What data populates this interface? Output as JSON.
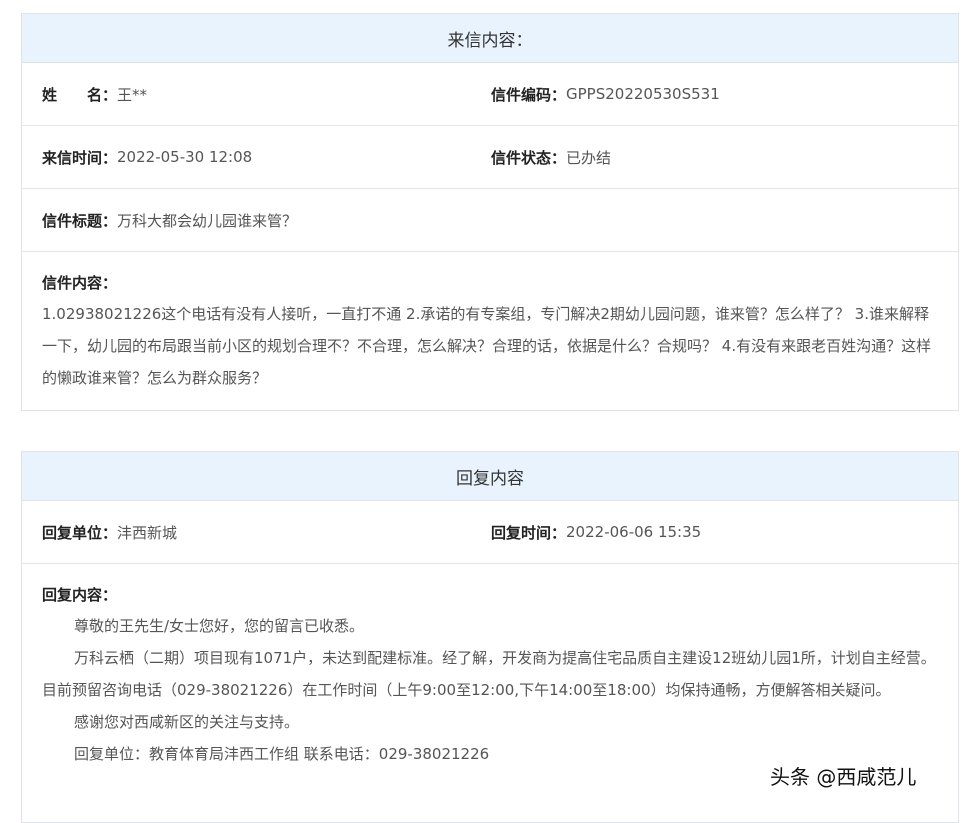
{
  "letter": {
    "header": "来信内容：",
    "name_label": "姓　　名：",
    "name_value": "王**",
    "code_label": "信件编码：",
    "code_value": "GPPS20220530S531",
    "time_label": "来信时间：",
    "time_value": "2022-05-30 12:08",
    "status_label": "信件状态：",
    "status_value": "已办结",
    "subject_label": "信件标题：",
    "subject_value": "万科大都会幼儿园谁来管？",
    "content_label": "信件内容：",
    "content_text": "1.02938021226这个电话有没有人接听，一直打不通 2.承诺的有专案组，专门解决2期幼儿园问题，谁来管？怎么样了？ 3.谁来解释一下，幼儿园的布局跟当前小区的规划合理不？不合理，怎么解决？合理的话，依据是什么？合规吗？ 4.有没有来跟老百姓沟通？这样的懒政谁来管？怎么为群众服务？"
  },
  "reply": {
    "header": "回复内容",
    "unit_label": "回复单位：",
    "unit_value": "沣西新城",
    "time_label": "回复时间：",
    "time_value": "2022-06-06 15:35",
    "content_label": "回复内容：",
    "paragraphs": [
      "尊敬的王先生/女士您好，您的留言已收悉。",
      "万科云栖（二期）项目现有1071户，未达到配建标准。经了解，开发商为提高住宅品质自主建设12班幼儿园1所，计划自主经营。目前预留咨询电话（029-38021226）在工作时间（上午9:00至12:00,下午14:00至18:00）均保持通畅，方便解答相关疑问。",
      "感谢您对西咸新区的关注与支持。",
      "回复单位：教育体育局沣西工作组 联系电话：029-38021226"
    ]
  },
  "watermark": "头条 @西咸范儿"
}
